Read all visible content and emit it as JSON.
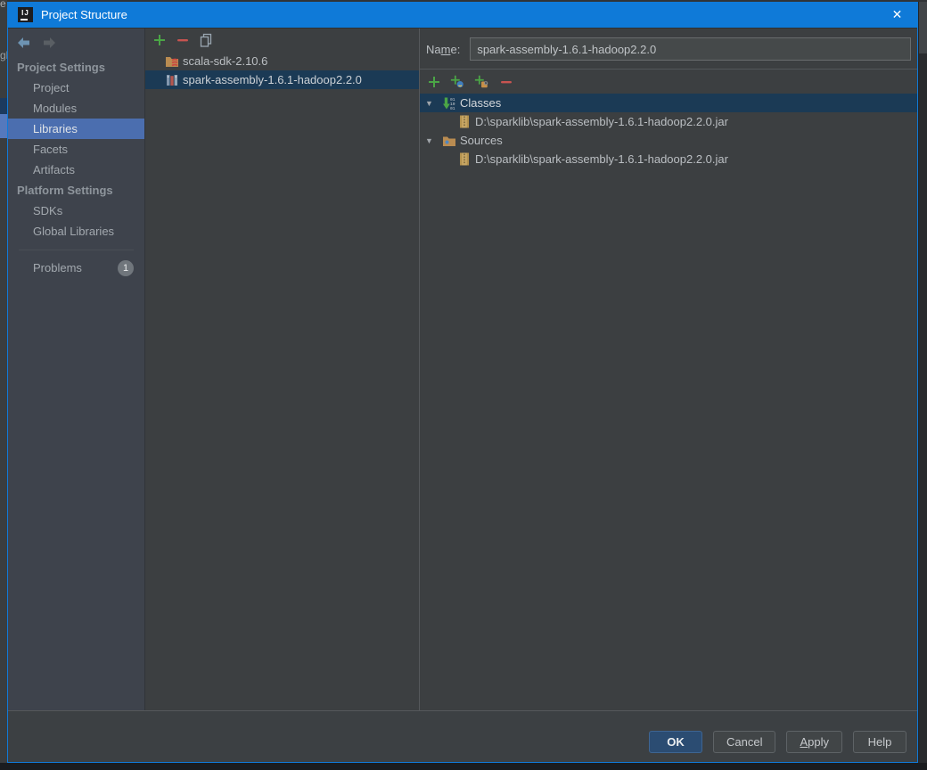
{
  "window": {
    "title": "Project Structure",
    "close_glyph": "✕",
    "logo_text": "IJ"
  },
  "background_fragments": {
    "top_left": "e",
    "mid_left": "gh"
  },
  "sidebar": {
    "sections": [
      {
        "header": "Project Settings",
        "items": [
          {
            "label": "Project"
          },
          {
            "label": "Modules"
          },
          {
            "label": "Libraries",
            "selected": true
          },
          {
            "label": "Facets"
          },
          {
            "label": "Artifacts"
          }
        ]
      },
      {
        "header": "Platform Settings",
        "items": [
          {
            "label": "SDKs"
          },
          {
            "label": "Global Libraries"
          }
        ]
      }
    ],
    "problems": {
      "label": "Problems",
      "badge": "1"
    }
  },
  "library_list": {
    "toolbar": [
      {
        "name": "add"
      },
      {
        "name": "remove"
      },
      {
        "name": "copy"
      }
    ],
    "items": [
      {
        "label": "scala-sdk-2.10.6",
        "icon": "scala-sdk",
        "selected": false
      },
      {
        "label": "spark-assembly-1.6.1-hadoop2.2.0",
        "icon": "library",
        "selected": true
      }
    ]
  },
  "detail": {
    "name_label_parts": {
      "pre": "Na",
      "mnemonic": "m",
      "post": "e:"
    },
    "name_value": "spark-assembly-1.6.1-hadoop2.2.0",
    "toolbar": [
      {
        "name": "add"
      },
      {
        "name": "add-jar-directory"
      },
      {
        "name": "add-attachment"
      },
      {
        "name": "remove"
      }
    ],
    "tree": {
      "expand_glyph": "▼",
      "nodes": [
        {
          "label": "Classes",
          "icon": "classes-root",
          "selected": true,
          "children": [
            "D:\\sparklib\\spark-assembly-1.6.1-hadoop2.2.0.jar"
          ]
        },
        {
          "label": "Sources",
          "icon": "sources-root",
          "selected": false,
          "children": [
            "D:\\sparklib\\spark-assembly-1.6.1-hadoop2.2.0.jar"
          ]
        }
      ]
    }
  },
  "buttons": {
    "ok": "OK",
    "cancel": "Cancel",
    "apply_parts": {
      "mnemonic": "A",
      "post": "pply"
    },
    "help": "Help"
  },
  "colors": {
    "titlebar": "#0f7ad8",
    "selection_focused": "#4b6eaf",
    "selection_unfocused": "#1b3a55",
    "panel_bg": "#3c3f41",
    "sidebar_bg": "#3e434c",
    "add_green": "#4ba546",
    "remove_red": "#c75450"
  }
}
